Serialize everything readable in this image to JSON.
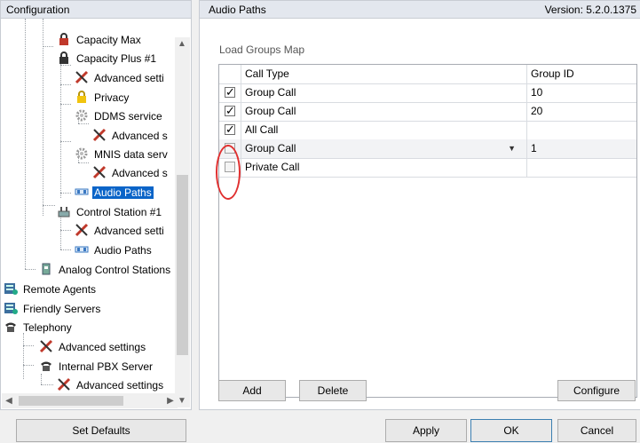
{
  "left_panel": {
    "title": "Configuration",
    "tree": [
      {
        "label": "Capacity Max",
        "icon": "lock-red-icon"
      },
      {
        "label": "Capacity Plus #1",
        "icon": "lock-dark-icon"
      },
      {
        "label": "Advanced setti",
        "icon": "tools-icon"
      },
      {
        "label": "Privacy",
        "icon": "padlock-icon"
      },
      {
        "label": "DDMS service",
        "icon": "gear-icon"
      },
      {
        "label": "Advanced s",
        "icon": "tools-icon"
      },
      {
        "label": "MNIS data serv",
        "icon": "gear-icon"
      },
      {
        "label": "Advanced s",
        "icon": "tools-icon"
      },
      {
        "label": "Audio Paths",
        "icon": "audio-paths-icon"
      },
      {
        "label": "Control Station #1",
        "icon": "control-station-icon"
      },
      {
        "label": "Advanced setti",
        "icon": "tools-icon"
      },
      {
        "label": "Audio Paths",
        "icon": "audio-paths-icon"
      },
      {
        "label": "Analog Control Stations",
        "icon": "analog-station-icon"
      },
      {
        "label": "Remote Agents",
        "icon": "server-icon"
      },
      {
        "label": "Friendly Servers",
        "icon": "server-icon"
      },
      {
        "label": "Telephony",
        "icon": "phone-icon"
      },
      {
        "label": "Advanced settings",
        "icon": "tools-icon"
      },
      {
        "label": "Internal PBX Server",
        "icon": "phone-icon"
      },
      {
        "label": "Advanced settings",
        "icon": "tools-icon"
      }
    ],
    "set_defaults_label": "Set Defaults"
  },
  "right_panel": {
    "title": "Audio Paths",
    "version": "Version: 5.2.0.1375",
    "group_title": "Load Groups Map",
    "columns": [
      "Call Type",
      "Group ID"
    ],
    "rows": [
      {
        "checked": true,
        "call_type": "Group Call",
        "group_id": "10"
      },
      {
        "checked": true,
        "call_type": "Group Call",
        "group_id": "20"
      },
      {
        "checked": true,
        "call_type": "All Call",
        "group_id": ""
      },
      {
        "checked": false,
        "call_type": "Group Call",
        "group_id": "1"
      },
      {
        "checked": false,
        "call_type": "Private Call",
        "group_id": ""
      }
    ],
    "buttons": {
      "add": "Add",
      "delete": "Delete",
      "configure": "Configure"
    }
  },
  "footer": {
    "apply": "Apply",
    "ok": "OK",
    "cancel": "Cancel"
  },
  "colors": {
    "selection": "#0a64c8",
    "annotation": "#e03030"
  }
}
